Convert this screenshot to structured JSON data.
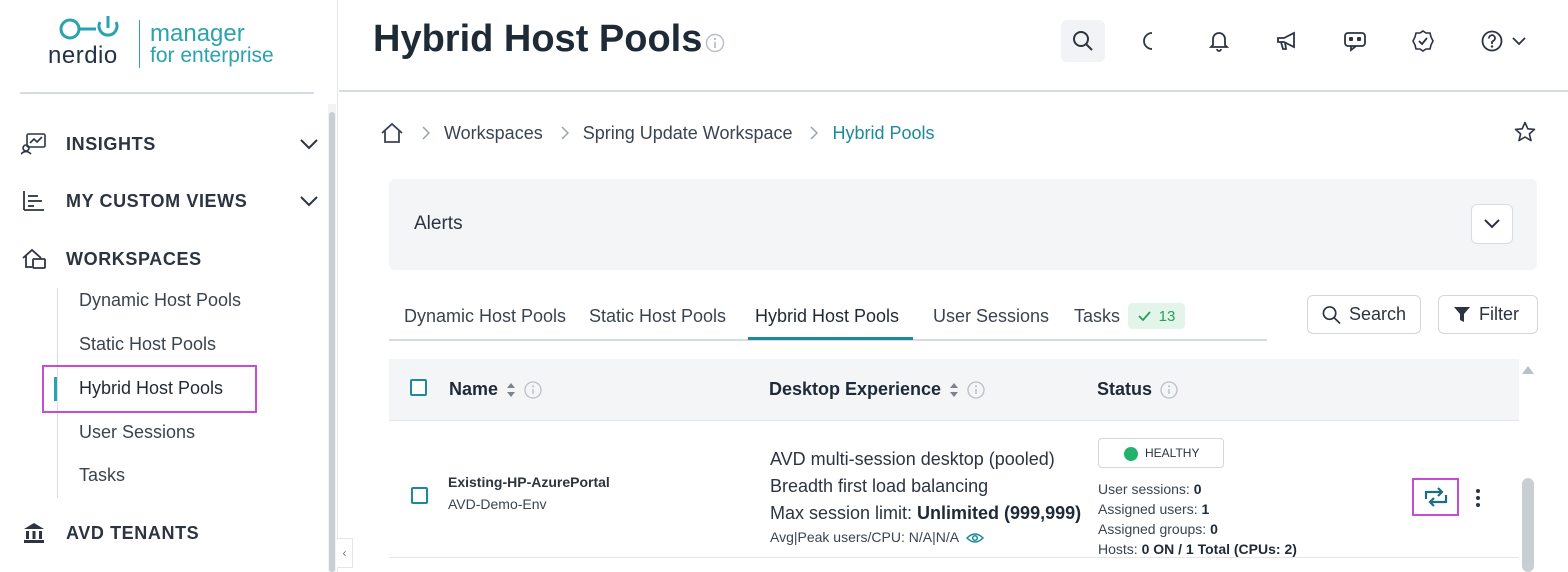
{
  "brand": {
    "name": "nerdio",
    "product_line1": "manager",
    "product_line2": "for enterprise",
    "accent_color": "#2aa3b0",
    "highlight_color": "#c84bd6"
  },
  "sidebar": {
    "sections": [
      {
        "label": "INSIGHTS",
        "icon": "insights-icon",
        "expandable": true
      },
      {
        "label": "MY CUSTOM VIEWS",
        "icon": "custom-views-icon",
        "expandable": true
      },
      {
        "label": "WORKSPACES",
        "icon": "workspaces-icon",
        "expandable": false
      },
      {
        "label": "AVD TENANTS",
        "icon": "bank-icon",
        "expandable": false
      }
    ],
    "workspace_items": [
      {
        "label": "Dynamic Host Pools",
        "active": false
      },
      {
        "label": "Static Host Pools",
        "active": false
      },
      {
        "label": "Hybrid Host Pools",
        "active": true
      },
      {
        "label": "User Sessions",
        "active": false
      },
      {
        "label": "Tasks",
        "active": false
      }
    ],
    "collapse_glyph": "‹"
  },
  "header": {
    "title": "Hybrid Host Pools",
    "icons": [
      "search-icon",
      "moon-icon",
      "bell-icon",
      "megaphone-icon",
      "chat-bot-icon",
      "badge-check-icon",
      "help-icon",
      "chevron-down-icon"
    ]
  },
  "breadcrumb": {
    "items": [
      "Workspaces",
      "Spring Update Workspace",
      "Hybrid Pools"
    ]
  },
  "alerts": {
    "title": "Alerts"
  },
  "tabs": {
    "items": [
      "Dynamic Host Pools",
      "Static Host Pools",
      "Hybrid Host Pools",
      "User Sessions",
      "Tasks"
    ],
    "active": "Hybrid Host Pools",
    "tasks_count": "13"
  },
  "toolbar": {
    "search_label": "Search",
    "filter_label": "Filter"
  },
  "table": {
    "columns": [
      "Name",
      "Desktop Experience",
      "Status"
    ],
    "rows": [
      {
        "name": "Existing-HP-AzurePortal",
        "subname": "AVD-Demo-Env",
        "desktop_type": "AVD multi-session desktop (pooled)",
        "load_balancing": "Breadth first load balancing",
        "max_session_label": "Max session limit:",
        "max_session_value": "Unlimited (999,999)",
        "avg_peak_label": "Avg|Peak users/CPU:",
        "avg_peak_value": "N/A|N/A",
        "status": "HEALTHY",
        "user_sessions_label": "User sessions:",
        "user_sessions": "0",
        "assigned_users_label": "Assigned users:",
        "assigned_users": "1",
        "assigned_groups_label": "Assigned groups:",
        "assigned_groups": "0",
        "hosts_label": "Hosts:",
        "hosts": "0 ON / 1 Total (CPUs: 2)"
      }
    ]
  }
}
